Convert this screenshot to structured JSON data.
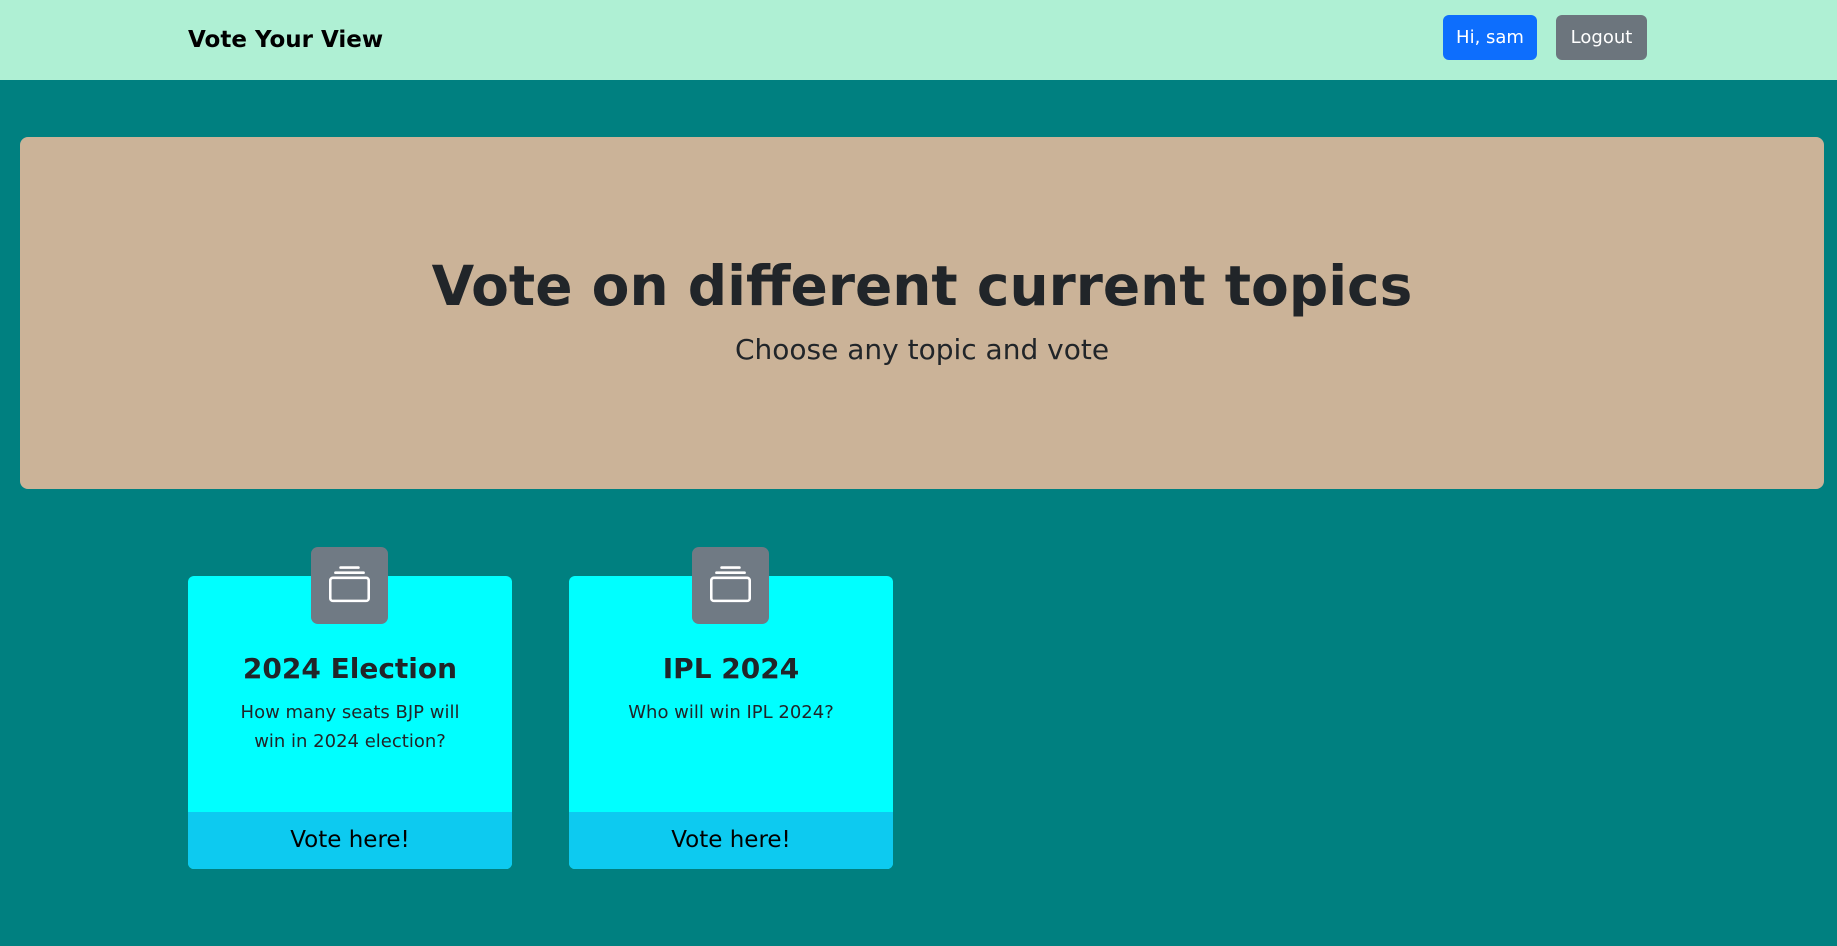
{
  "navbar": {
    "brand": "Vote Your View",
    "user_button": "Hi, sam",
    "logout_button": "Logout"
  },
  "hero": {
    "title": "Vote on different current topics",
    "subtitle": "Choose any topic and vote"
  },
  "cards": [
    {
      "icon": "collection-icon",
      "title": "2024 Election",
      "text": "How many seats BJP will win in 2024 election?",
      "action": "Vote here!"
    },
    {
      "icon": "collection-icon",
      "title": "IPL 2024",
      "text": "Who will win IPL 2024?",
      "action": "Vote here!"
    }
  ],
  "colors": {
    "page_background": "#008080",
    "navbar_background": "#aff0d4",
    "hero_background": "#cbb398",
    "card_background": "#00ffff",
    "card_footer": "#0dcaf0",
    "primary": "#0d6efd",
    "secondary": "#6c757d"
  }
}
